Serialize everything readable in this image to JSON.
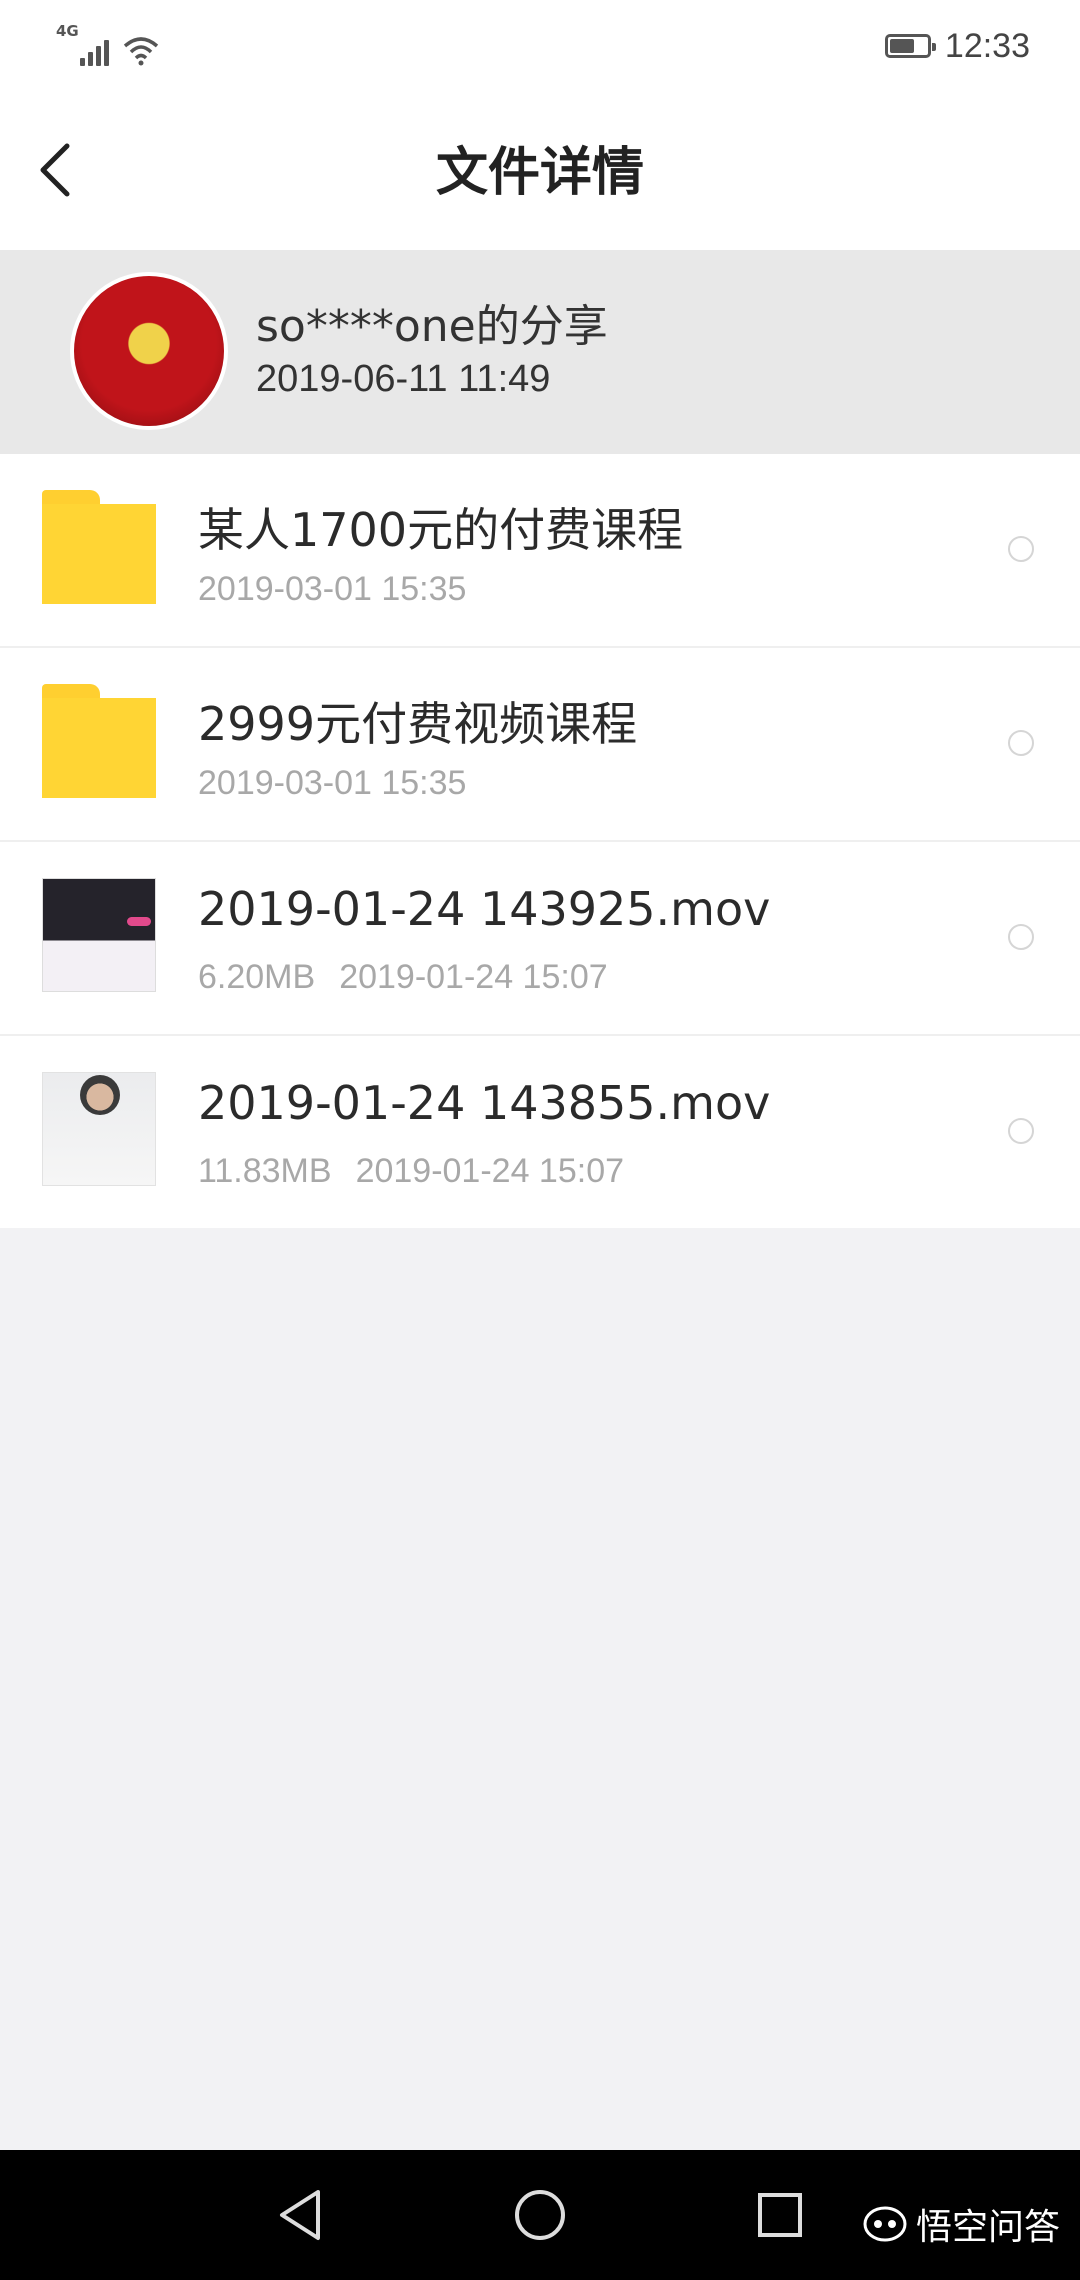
{
  "status_bar": {
    "network": "4G",
    "time": "12:33"
  },
  "header": {
    "title": "文件详情"
  },
  "share": {
    "owner": "so****one的分享",
    "time": "2019-06-11  11:49"
  },
  "files": [
    {
      "name": "某人1700元的付费课程",
      "size": "",
      "date": "2019-03-01  15:35",
      "icon": "folder-icon"
    },
    {
      "name": "2999元付费视频课程",
      "size": "",
      "date": "2019-03-01  15:35",
      "icon": "folder-icon"
    },
    {
      "name": "2019-01-24 143925.mov",
      "size": "6.20MB",
      "date": "2019-01-24  15:07",
      "icon": "video-thumbnail"
    },
    {
      "name": "2019-01-24 143855.mov",
      "size": "11.83MB",
      "date": "2019-01-24  15:07",
      "icon": "video-thumbnail"
    }
  ],
  "watermark": {
    "text": "悟空问答"
  },
  "colors": {
    "folder": "#ffd534",
    "header_background": "#e8e8e8",
    "meta_text": "#a8a8a8"
  }
}
